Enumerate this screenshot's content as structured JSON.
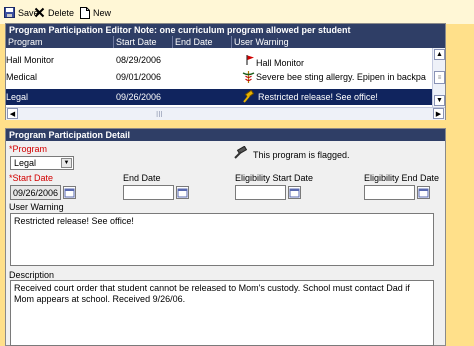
{
  "toolbar": {
    "save_label": "Save",
    "delete_label": "Delete",
    "new_label": "New"
  },
  "editor": {
    "title": "Program Participation Editor Note: one curriculum program allowed per student",
    "columns": [
      "Program",
      "Start Date",
      "End Date",
      "User Warning"
    ],
    "rows": [
      {
        "program": "Hall Monitor",
        "start_date": "08/29/2006",
        "end_date": "",
        "warning": "Hall Monitor"
      },
      {
        "program": "Medical",
        "start_date": "09/01/2006",
        "end_date": "",
        "warning": "Severe bee sting allergy. Epipen in backpa"
      },
      {
        "program": "Legal",
        "start_date": "09/26/2006",
        "end_date": "",
        "warning": "Restricted release! See office!"
      }
    ],
    "hscroll_grip": "III"
  },
  "detail": {
    "title": "Program Participation Detail",
    "program_label": "*Program",
    "program_value": "Legal",
    "flag_message": "This program is flagged.",
    "start_date_label": "*Start Date",
    "start_date_value": "09/26/2006",
    "end_date_label": "End Date",
    "end_date_value": "",
    "elig_start_label": "Eligibility Start Date",
    "elig_start_value": "",
    "elig_end_label": "Eligibility End Date",
    "elig_end_value": "",
    "user_warning_label": "User Warning",
    "user_warning_value": "Restricted release!  See office!",
    "description_label": "Description",
    "description_value": "Received court order that student cannot be released to Mom's custody.  School must contact Dad if Mom appears at school.  Received 9/26/06."
  },
  "colors": {
    "background": "#ffe08a",
    "header_navy": "#2f3e66",
    "selected_row": "#10245e",
    "required_red": "#d20000"
  }
}
